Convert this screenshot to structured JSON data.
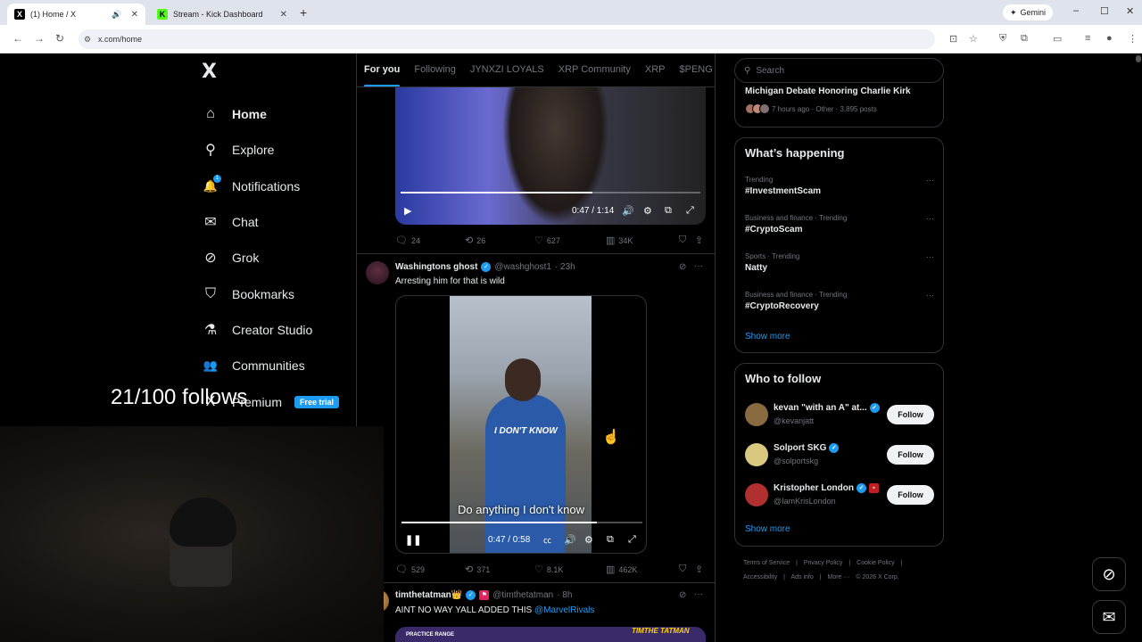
{
  "browser": {
    "tabs": [
      {
        "title": "(1) Home / X",
        "favicon": "X"
      },
      {
        "title": "Stream - Kick Dashboard",
        "favicon": "K"
      }
    ],
    "new_tab": "+",
    "gemini_label": "Gemini",
    "url": "x.com/home",
    "window_controls": {
      "minimize": "–",
      "maximize": "☐",
      "close": "✕"
    }
  },
  "sidebar": {
    "logo": "X",
    "items": [
      {
        "label": "Home",
        "icon": "home-icon",
        "glyph": "⌂"
      },
      {
        "label": "Explore",
        "icon": "search-icon",
        "glyph": "⚲"
      },
      {
        "label": "Notifications",
        "icon": "bell-icon",
        "glyph": "🔔",
        "badge": "1"
      },
      {
        "label": "Chat",
        "icon": "mail-icon",
        "glyph": "✉"
      },
      {
        "label": "Grok",
        "icon": "grok-icon",
        "glyph": "⊘"
      },
      {
        "label": "Bookmarks",
        "icon": "bookmark-icon",
        "glyph": "⛉"
      },
      {
        "label": "Creator Studio",
        "icon": "flask-icon",
        "glyph": "⚗"
      },
      {
        "label": "Communities",
        "icon": "people-icon",
        "glyph": "👥"
      },
      {
        "label": "Premium",
        "icon": "x-premium-icon",
        "glyph": "X"
      }
    ],
    "free_trial": "Free trial"
  },
  "overlay": {
    "follows": "21/100 follows"
  },
  "feed": {
    "tabs": [
      "For you",
      "Following",
      "JYNXZI LOYALS",
      "XRP Community",
      "XRP",
      "$PENG"
    ],
    "post1": {
      "time": "0:47 / 1:14",
      "progress": 0.64,
      "stats": {
        "replies": "24",
        "reposts": "26",
        "likes": "627",
        "views": "34K"
      }
    },
    "post2": {
      "name": "Washingtons ghost",
      "handle": "@washghost1",
      "time": "· 23h",
      "text": "Arresting him for that is wild",
      "video_overlay": "I DON'T KNOW",
      "caption": "Do anything I don't know",
      "player_time": "0:47 / 0:58",
      "progress": 0.81,
      "stats": {
        "replies": "529",
        "reposts": "371",
        "likes": "8.1K",
        "views": "462K"
      }
    },
    "post3": {
      "name": "timthetatman👑",
      "handle": "@timthetatman",
      "time": "· 8h",
      "text": "AINT NO WAY YALL ADDED THIS",
      "mention": "@MarvelRivals",
      "video_label": "PRACTICE RANGE",
      "video_logo": "TIMTHE TATMAN"
    }
  },
  "right": {
    "search_placeholder": "Search",
    "top_story": {
      "title": "Michigan Debate Honoring Charlie Kirk",
      "meta": "7 hours ago · Other · 3,895 posts"
    },
    "whats_happening": {
      "heading": "What’s happening",
      "trends": [
        {
          "category": "Trending",
          "tag": "#InvestmentScam"
        },
        {
          "category": "Business and finance · Trending",
          "tag": "#CryptoScam"
        },
        {
          "category": "Sports · Trending",
          "tag": "Natty"
        },
        {
          "category": "Business and finance · Trending",
          "tag": "#CryptoRecovery"
        }
      ],
      "show_more": "Show more"
    },
    "who_to_follow": {
      "heading": "Who to follow",
      "users": [
        {
          "name": "kevan \"with an A\" at...",
          "handle": "@kevanjatt",
          "button": "Follow",
          "avatar_color": "#8a6a40"
        },
        {
          "name": "Solport SKG",
          "handle": "@solportskg",
          "button": "Follow",
          "avatar_color": "#d8c880"
        },
        {
          "name": "Kristopher London",
          "handle": "@IamKrisLondon",
          "button": "Follow",
          "avatar_color": "#b03030"
        }
      ],
      "show_more": "Show more"
    },
    "footer": {
      "line1": [
        "Terms of Service",
        "|",
        "Privacy Policy",
        "|",
        "Cookie Policy",
        "|"
      ],
      "line2": [
        "Accessibility",
        "|",
        "Ads info",
        "|",
        "More ···",
        "© 2026 X Corp."
      ]
    }
  },
  "colors": {
    "accent": "#1d9bf0",
    "background": "#000000",
    "border": "#2f3336",
    "muted": "#71767b"
  }
}
